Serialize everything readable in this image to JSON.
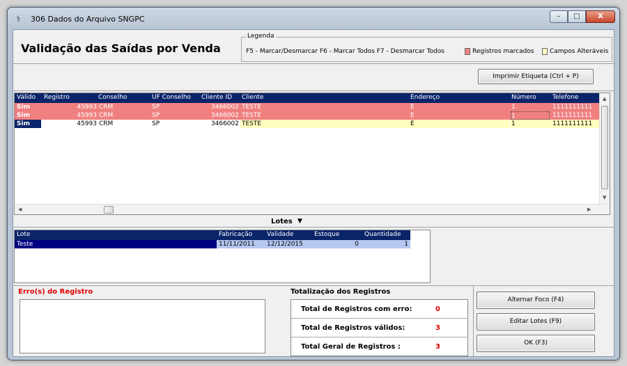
{
  "window": {
    "title": "306 Dados do Arquivo SNGPC",
    "minimize": "–",
    "maximize": "□",
    "close": "X"
  },
  "header": {
    "page_title": "Validação das Saídas por Venda"
  },
  "legend": {
    "title": "Legenda",
    "shortcuts": "F5 - Marcar/Desmarcar  F6 - Marcar Todos  F7 - Desmarcar Todos",
    "marked_label": "Registros marcados",
    "editable_label": "Campos Alteráveis",
    "marked_color": "#f08080",
    "editable_color": "#ffffc0"
  },
  "toolbar": {
    "print_button": "Imprimir Etiqueta (Ctrl + P)"
  },
  "grid": {
    "columns": [
      "Válido",
      "Registro",
      "Conselho",
      "UF Conselho",
      "Cliente ID",
      "Cliente",
      "Endereço",
      "Número",
      "Telefone"
    ],
    "rows": [
      {
        "valido": "Sim",
        "registro": "45993",
        "conselho": "CRM",
        "uf": "SP",
        "cliente_id": "3466002",
        "cliente": "TESTE",
        "endereco": "E",
        "numero": "1",
        "telefone": "1111111111",
        "state": "marked"
      },
      {
        "valido": "Sim",
        "registro": "45993",
        "conselho": "CRM",
        "uf": "SP",
        "cliente_id": "3466002",
        "cliente": "TESTE",
        "endereco": "E",
        "numero": "1",
        "telefone": "1111111111",
        "state": "marked"
      },
      {
        "valido": "Sim",
        "registro": "45993",
        "conselho": "CRM",
        "uf": "SP",
        "cliente_id": "3466002",
        "cliente": "TESTE",
        "endereco": "E",
        "numero": "1",
        "telefone": "1111111111",
        "state": "normal"
      }
    ]
  },
  "lotes": {
    "label": "Lotes",
    "columns": [
      "Lote",
      "Fabricação",
      "Validade",
      "Estoque",
      "Quantidade"
    ],
    "rows": [
      {
        "lote": "Teste",
        "fabricacao": "11/11/2011",
        "validade": "12/12/2015",
        "estoque": "0",
        "quantidade": "1"
      }
    ]
  },
  "errors": {
    "title": "Erro(s) do Registro"
  },
  "totals": {
    "title": "Totalização dos Registros",
    "rows": [
      {
        "label": "Total de Registros com erro:",
        "value": "0"
      },
      {
        "label": "Total de Registros válidos:",
        "value": "3"
      },
      {
        "label": "Total Geral de Registros :",
        "value": "3"
      }
    ]
  },
  "actions": {
    "alternar": "Alternar Foco (F4)",
    "editar": "Editar Lotes (F9)",
    "ok": "OK (F3)"
  }
}
